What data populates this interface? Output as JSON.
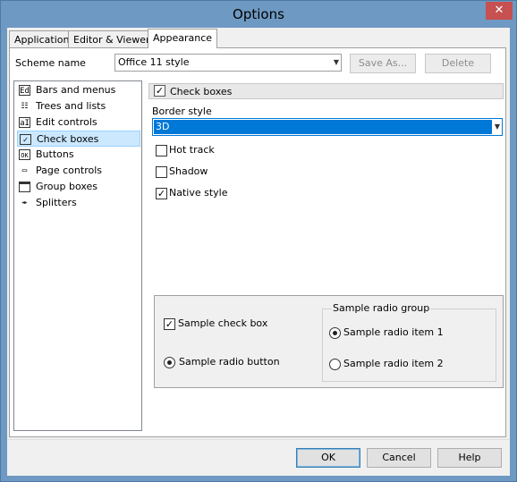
{
  "window": {
    "title": "Options",
    "close_glyph": "✕"
  },
  "tabs": [
    {
      "label": "Application"
    },
    {
      "label": "Editor & Viewers"
    },
    {
      "label": "Appearance"
    }
  ],
  "scheme": {
    "label": "Scheme name",
    "value": "Office 11 style",
    "save_as": "Save As...",
    "delete": "Delete"
  },
  "tree": {
    "items": [
      {
        "label": "Bars and menus",
        "icon": "bars-menus-icon"
      },
      {
        "label": "Trees and lists",
        "icon": "tree-list-icon"
      },
      {
        "label": "Edit controls",
        "icon": "edit-control-icon"
      },
      {
        "label": "Check boxes",
        "icon": "checkbox-icon"
      },
      {
        "label": "Buttons",
        "icon": "button-icon"
      },
      {
        "label": "Page controls",
        "icon": "page-control-icon"
      },
      {
        "label": "Group boxes",
        "icon": "groupbox-icon"
      },
      {
        "label": "Splitters",
        "icon": "splitter-icon"
      }
    ],
    "selected": "Check boxes"
  },
  "panel": {
    "header": "Check boxes",
    "border_style_label": "Border style",
    "border_style_value": "3D",
    "hot_track": "Hot track",
    "shadow": "Shadow",
    "native_style": "Native style",
    "hot_track_checked": false,
    "shadow_checked": false,
    "native_style_checked": true
  },
  "sample": {
    "check_box": "Sample check box",
    "radio_button": "Sample radio button",
    "group_title": "Sample radio group",
    "radio_item_1": "Sample radio item 1",
    "radio_item_2": "Sample radio item 2"
  },
  "footer": {
    "ok": "OK",
    "cancel": "Cancel",
    "help": "Help"
  },
  "colors": {
    "title_bar": "#6e99c2",
    "close_button": "#c75050",
    "selection": "#0078d7"
  }
}
